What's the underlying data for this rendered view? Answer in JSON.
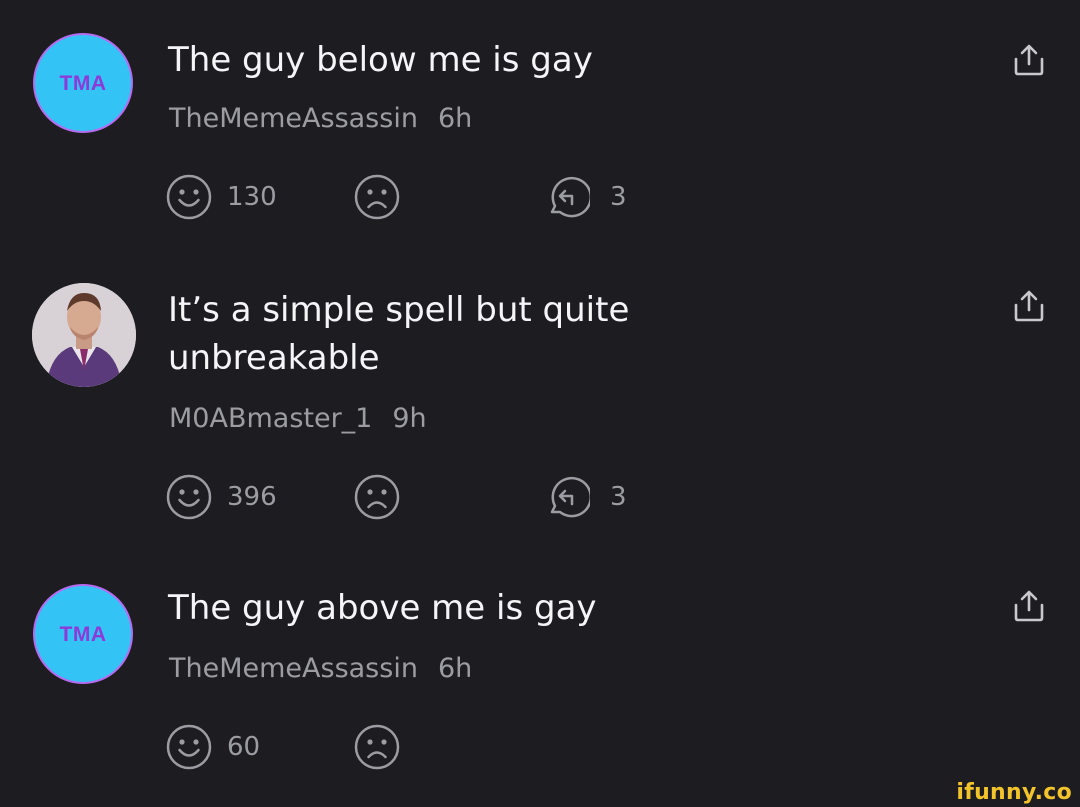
{
  "comments": [
    {
      "avatar_initials": "TMA",
      "text": "The guy below me is gay",
      "username": "TheMemeAssassin",
      "time": "6h",
      "smile_count": "130",
      "reply_count": "3",
      "icons": {
        "smile": "smile-icon",
        "frown": "frown-icon",
        "reply": "reply-icon",
        "share": "share-icon"
      }
    },
    {
      "avatar_initials": "",
      "text": "It’s a simple spell but quite unbreakable",
      "username": "M0ABmaster_1",
      "time": "9h",
      "smile_count": "396",
      "reply_count": "3",
      "icons": {
        "smile": "smile-icon",
        "frown": "frown-icon",
        "reply": "reply-icon",
        "share": "share-icon"
      }
    },
    {
      "avatar_initials": "TMA",
      "text": "The guy above me is gay",
      "username": "TheMemeAssassin",
      "time": "6h",
      "smile_count": "60",
      "icons": {
        "smile": "smile-icon",
        "frown": "frown-icon",
        "share": "share-icon"
      }
    }
  ],
  "watermark": "ifunny.co",
  "colors": {
    "background": "#1c1c21",
    "text": "#f5f5f7",
    "meta": "#9c9ca3",
    "avatar_bg": "#33c4f5",
    "avatar_text": "#8e3ad8",
    "watermark": "#f2c32a"
  }
}
